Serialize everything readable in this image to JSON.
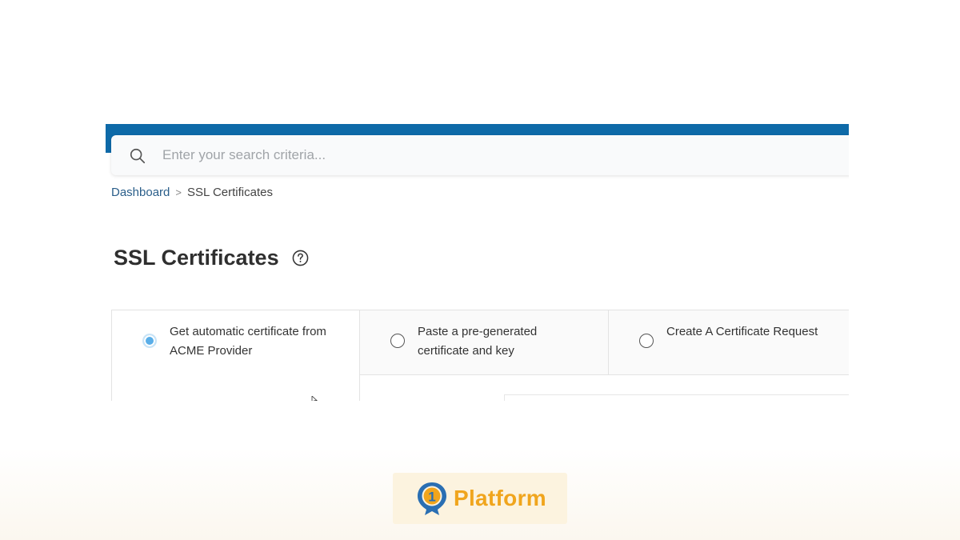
{
  "search": {
    "placeholder": "Enter your search criteria..."
  },
  "breadcrumb": {
    "home": "Dashboard",
    "separator": ">",
    "current": "SSL Certificates"
  },
  "page": {
    "title": "SSL Certificates"
  },
  "options": [
    {
      "label": "Get automatic certificate from ACME Provider",
      "selected": true
    },
    {
      "label": "Paste a pre-generated certificate and key",
      "selected": false
    },
    {
      "label": "Create A Certificate Request",
      "selected": false
    }
  ],
  "logo": {
    "digit": "1",
    "text": "Platform"
  },
  "colors": {
    "topbar": "#0e6aa8",
    "link": "#2a5e8a",
    "radio_checked": "#5aaee8",
    "logo_text": "#f0a51d",
    "logo_mark": "#2a6fb3"
  },
  "icons": {
    "search": "search-icon",
    "help": "help-icon"
  }
}
